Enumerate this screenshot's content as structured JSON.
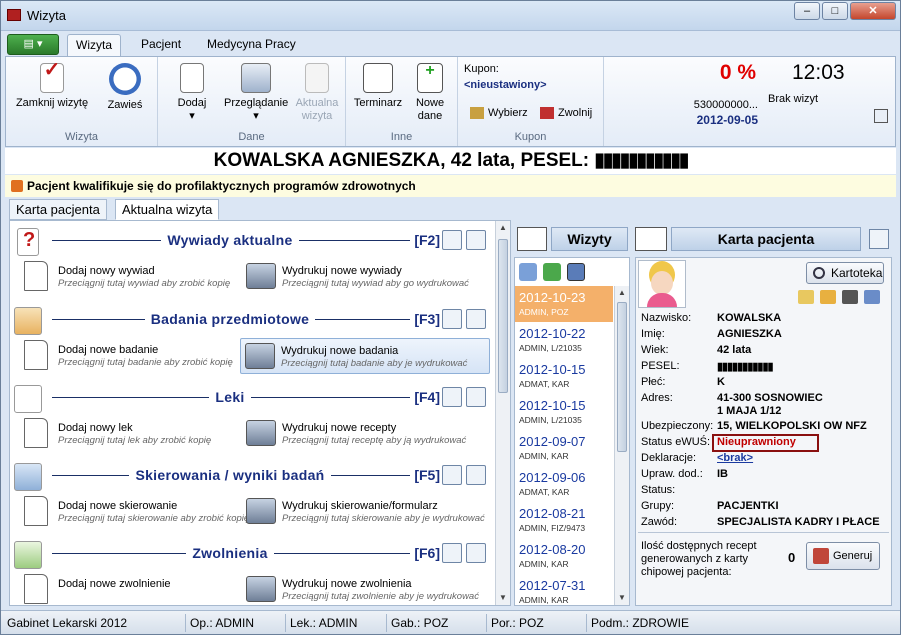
{
  "window": {
    "title": "Wizyta"
  },
  "ribbon_tabs": [
    "Wizyta",
    "Pacjent",
    "Medycyna Pracy"
  ],
  "ribbon": {
    "wizyta_group": {
      "label": "Wizyta",
      "zamknij": "Zamknij wizytę",
      "zawies": "Zawieś"
    },
    "dane_group": {
      "label": "Dane",
      "dodaj": "Dodaj",
      "przegladanie": "Przeglądanie",
      "aktualna_line1": "Aktualna",
      "aktualna_line2": "wizyta"
    },
    "inne_group": {
      "label": "Inne",
      "terminarz": "Terminarz",
      "nowe_line1": "Nowe",
      "nowe_line2": "dane"
    },
    "kupon_group": {
      "label": "Kupon",
      "kupon_label": "Kupon:",
      "kupon_value": "<nieustawiony>",
      "wybierz": "Wybierz",
      "zwolnij": "Zwolnij"
    },
    "status": {
      "percent": "0 %",
      "number": "530000000...",
      "date": "2012-09-05",
      "time": "12:03",
      "brak_wizyt": "Brak wizyt"
    }
  },
  "patient": {
    "header": "KOWALSKA AGNIESZKA, 42 lata, PESEL: ",
    "pesel_mask": "▮▮▮▮▮▮▮▮▮▮▮",
    "notice": "Pacjent kwalifikuje się do profilaktycznych programów zdrowotnych"
  },
  "sub_tabs": [
    "Karta pacjenta",
    "Aktualna wizyta"
  ],
  "sections": [
    {
      "title": "Wywiady aktualne",
      "key": "[F2]",
      "left": {
        "title": "Dodaj nowy wywiad",
        "sub": "Przeciągnij tutaj wywiad aby zrobić kopię"
      },
      "right": {
        "title": "Wydrukuj nowe wywiady",
        "sub": "Przeciągnij tutaj wywiad aby go wydrukować"
      }
    },
    {
      "title": "Badania przedmiotowe",
      "key": "[F3]",
      "left": {
        "title": "Dodaj nowe badanie",
        "sub": "Przeciągnij tutaj badanie aby zrobić kopię"
      },
      "right": {
        "title": "Wydrukuj nowe badania",
        "sub": "Przeciągnij tutaj badanie aby je wydrukować"
      }
    },
    {
      "title": "Leki",
      "key": "[F4]",
      "left": {
        "title": "Dodaj nowy lek",
        "sub": "Przeciągnij tutaj lek aby zrobić kopię"
      },
      "right": {
        "title": "Wydrukuj nowe recepty",
        "sub": "Przeciągnij tutaj receptę aby ją wydrukować"
      }
    },
    {
      "title": "Skierowania / wyniki badań",
      "key": "[F5]",
      "left": {
        "title": "Dodaj nowe skierowanie",
        "sub": "Przeciągnij tutaj skierowanie aby zrobić kopię"
      },
      "right": {
        "title": "Wydrukuj skierowanie/formularz",
        "sub": "Przeciągnij tutaj skierowanie aby je wydrukować"
      }
    },
    {
      "title": "Zwolnienia",
      "key": "[F6]",
      "left": {
        "title": "Dodaj nowe zwolnienie",
        "sub": ""
      },
      "right": {
        "title": "Wydrukuj nowe zwolnienia",
        "sub": "Przeciągnij tutaj zwolnienie aby je wydrukować"
      }
    }
  ],
  "visits": {
    "title": "Wizyty",
    "items": [
      {
        "date": "2012-10-23",
        "user": "ADMIN, POZ"
      },
      {
        "date": "2012-10-22",
        "user": "ADMIN, L/21035"
      },
      {
        "date": "2012-10-15",
        "user": "ADMAT, KAR"
      },
      {
        "date": "2012-10-15",
        "user": "ADMIN, L/21035"
      },
      {
        "date": "2012-09-07",
        "user": "ADMIN, KAR"
      },
      {
        "date": "2012-09-06",
        "user": "ADMAT, KAR"
      },
      {
        "date": "2012-08-21",
        "user": "ADMIN, FIZ/9473"
      },
      {
        "date": "2012-08-20",
        "user": "ADMIN, KAR"
      },
      {
        "date": "2012-07-31",
        "user": "ADMIN, KAR"
      }
    ]
  },
  "card": {
    "title": "Karta pacjenta",
    "kartoteka": "Kartoteka",
    "labels": [
      "Nazwisko:",
      "Imię:",
      "Wiek:",
      "PESEL:",
      "Płeć:",
      "Adres:",
      "Ubezpieczony:",
      "Status eWUŚ:",
      "Deklaracje:",
      "Upraw. dod.:",
      "Status:",
      "Grupy:",
      "Zawód:"
    ],
    "values": {
      "nazwisko": "KOWALSKA",
      "imie": "AGNIESZKA",
      "wiek": "42 lata",
      "pesel": "▮▮▮▮▮▮▮▮▮▮▮",
      "plec": "K",
      "adres1": "41-300 SOSNOWIEC",
      "adres2": "1 MAJA 1/12",
      "ubezpieczony": "15, WIELKOPOLSKI OW NFZ",
      "ewus": "Nieuprawniony",
      "deklaracje": "<brak>",
      "upraw": "IB",
      "status": "",
      "grupy": "PACJENTKI",
      "zawod": "SPECJALISTA KADRY I PŁACE"
    },
    "recepty_text": "Ilość dostępnych recept generowanych z karty chipowej pacjenta:",
    "recepty_count": "0",
    "generuj": "Generuj"
  },
  "statusbar": [
    "Gabinet Lekarski 2012",
    "Op.: ADMIN",
    "Lek.: ADMIN",
    "Gab.: POZ",
    "Por.: POZ",
    "Podm.: ZDROWIE"
  ],
  "colors": {
    "accent_red": "#c00000",
    "link_blue": "#1a3aa0",
    "selected_visit": "#f4b06a"
  }
}
